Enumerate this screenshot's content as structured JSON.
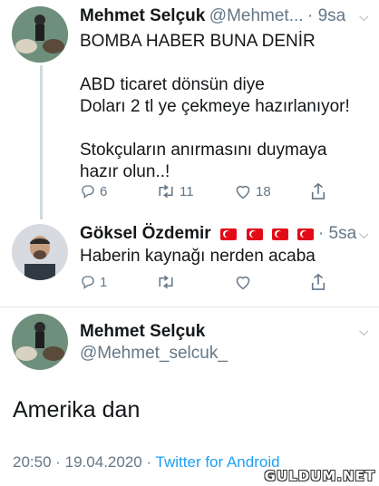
{
  "tweet1": {
    "name": "Mehmet Selçuk",
    "handle": "@Mehmet...",
    "time": "· 9sa",
    "lines": [
      "BOMBA HABER BUNA DENİR",
      "",
      "ABD ticaret dönsün diye",
      "Doları 2 tl ye çekmeye hazırlanıyor!",
      "",
      "Stokçuların anırmasını duymaya",
      "hazır olun..!"
    ],
    "replies": "6",
    "retweets": "11",
    "likes": "18"
  },
  "tweet2": {
    "name": "Göksel Özdemir",
    "time": "· 5sa",
    "text": "Haberin kaynağı nerden acaba",
    "replies": "1"
  },
  "tweet3": {
    "name": "Mehmet Selçuk",
    "handle": "@Mehmet_selcuk_",
    "text": "Amerika dan",
    "datetime": "20:50 · 19.04.2020 · ",
    "source": "Twitter for Android"
  },
  "watermark": "GULDUM.NET",
  "colors": {
    "accent": "#1da1f2",
    "muted": "#657786",
    "flag": "#e30a17"
  }
}
